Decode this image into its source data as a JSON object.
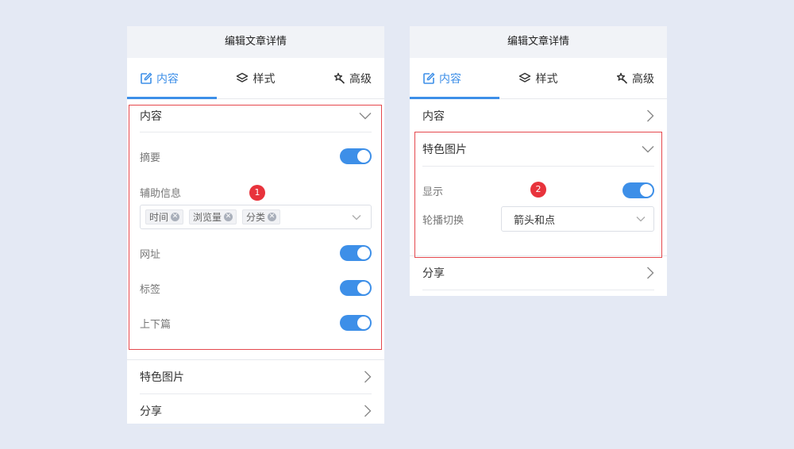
{
  "panel1": {
    "title": "编辑文章详情",
    "tabs": [
      {
        "label": "内容",
        "icon": "edit-icon",
        "active": true
      },
      {
        "label": "样式",
        "icon": "layers-icon",
        "active": false
      },
      {
        "label": "高级",
        "icon": "magic-wand-icon",
        "active": false
      }
    ],
    "content_section": {
      "title": "内容",
      "items": [
        {
          "label": "摘要",
          "on": true
        },
        {
          "label": "网址",
          "on": true
        },
        {
          "label": "标签",
          "on": true
        },
        {
          "label": "上下篇",
          "on": true
        }
      ],
      "aux": {
        "label": "辅助信息",
        "chips": [
          "时间",
          "浏览量",
          "分类"
        ]
      }
    },
    "collapsed": [
      "特色图片",
      "分享"
    ],
    "badge": "1"
  },
  "panel2": {
    "title": "编辑文章详情",
    "tabs": [
      {
        "label": "内容",
        "icon": "edit-icon",
        "active": true
      },
      {
        "label": "样式",
        "icon": "layers-icon",
        "active": false
      },
      {
        "label": "高级",
        "icon": "magic-wand-icon",
        "active": false
      }
    ],
    "content_collapsed": "内容",
    "featured": {
      "title": "特色图片",
      "show_label": "显示",
      "show_on": true,
      "carousel_label": "轮播切换",
      "carousel_value": "箭头和点"
    },
    "share": "分享",
    "badge": "2"
  },
  "colors": {
    "accent": "#3d8fe8",
    "highlight_border": "#e5484d",
    "badge": "#e8333c",
    "background": "#e4e9f4"
  }
}
